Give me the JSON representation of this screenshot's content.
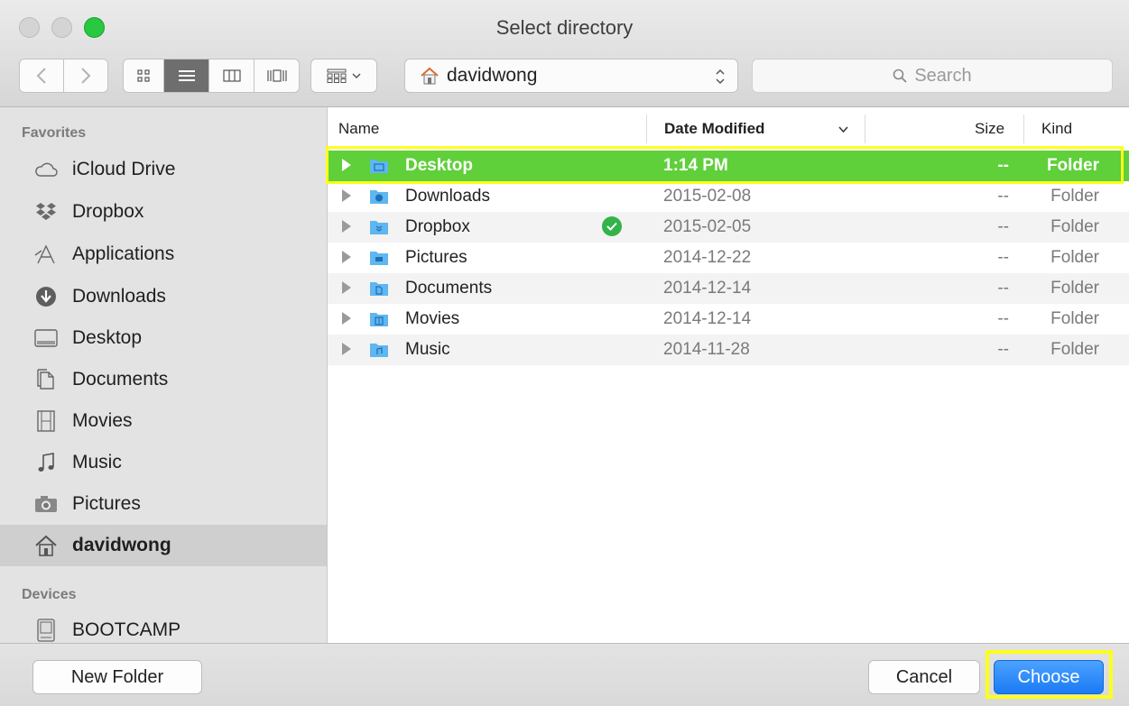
{
  "window": {
    "title": "Select directory"
  },
  "toolbar": {
    "path": "davidwong",
    "search_placeholder": "Search"
  },
  "sidebar": {
    "favorites_header": "Favorites",
    "favorites": [
      {
        "label": "iCloud Drive",
        "icon": "cloud-icon"
      },
      {
        "label": "Dropbox",
        "icon": "dropbox-icon"
      },
      {
        "label": "Applications",
        "icon": "applications-icon"
      },
      {
        "label": "Downloads",
        "icon": "downloads-icon"
      },
      {
        "label": "Desktop",
        "icon": "desktop-icon"
      },
      {
        "label": "Documents",
        "icon": "documents-icon"
      },
      {
        "label": "Movies",
        "icon": "movies-icon"
      },
      {
        "label": "Music",
        "icon": "music-icon"
      },
      {
        "label": "Pictures",
        "icon": "pictures-icon"
      },
      {
        "label": "davidwong",
        "icon": "home-icon",
        "selected": true
      }
    ],
    "devices_header": "Devices",
    "devices": [
      {
        "label": "BOOTCAMP",
        "icon": "drive-icon"
      }
    ]
  },
  "list": {
    "columns": {
      "name": "Name",
      "date": "Date Modified",
      "size": "Size",
      "kind": "Kind"
    },
    "rows": [
      {
        "name": "Desktop",
        "date": "1:14 PM",
        "size": "--",
        "kind": "Folder",
        "selected": true
      },
      {
        "name": "Downloads",
        "date": "2015-02-08",
        "size": "--",
        "kind": "Folder"
      },
      {
        "name": "Dropbox",
        "date": "2015-02-05",
        "size": "--",
        "kind": "Folder",
        "synced": true
      },
      {
        "name": "Pictures",
        "date": "2014-12-22",
        "size": "--",
        "kind": "Folder"
      },
      {
        "name": "Documents",
        "date": "2014-12-14",
        "size": "--",
        "kind": "Folder"
      },
      {
        "name": "Movies",
        "date": "2014-12-14",
        "size": "--",
        "kind": "Folder"
      },
      {
        "name": "Music",
        "date": "2014-11-28",
        "size": "--",
        "kind": "Folder"
      }
    ]
  },
  "buttons": {
    "new_folder": "New Folder",
    "cancel": "Cancel",
    "choose": "Choose"
  },
  "colors": {
    "selection": "#5fcf3a",
    "annotation_highlight": "#fcff1c",
    "primary_button": "#1a7af4"
  }
}
